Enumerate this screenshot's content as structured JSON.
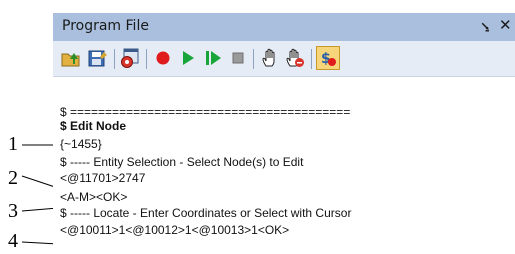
{
  "panel": {
    "title": "Program File",
    "pin_glyph": "⭸",
    "close_glyph": "✕"
  },
  "toolbar": {
    "buttons": [
      {
        "name": "open-folder-icon"
      },
      {
        "name": "save-file-icon"
      },
      {
        "name": "program-settings-icon"
      },
      {
        "name": "record-icon",
        "color": "#e01b1b"
      },
      {
        "name": "play-icon",
        "color": "#18a53a"
      },
      {
        "name": "step-icon",
        "color": "#18a53a"
      },
      {
        "name": "stop-icon",
        "color": "#9a9a9a"
      },
      {
        "name": "hand-icon"
      },
      {
        "name": "hand-stop-icon"
      },
      {
        "name": "script-icon",
        "active": true
      }
    ]
  },
  "code": {
    "lines": [
      "$ ========================================",
      "$ Edit Node",
      "{~1455}",
      "$ ----- Entity Selection - Select Node(s) to Edit",
      "<@11701>2747",
      "<A-M><OK>",
      "$ ----- Locate - Enter Coordinates or Select with Cursor",
      "<@10011>1<@10012>1<@10013>1<OK>"
    ]
  },
  "annotations": [
    "1",
    "2",
    "3",
    "4"
  ]
}
